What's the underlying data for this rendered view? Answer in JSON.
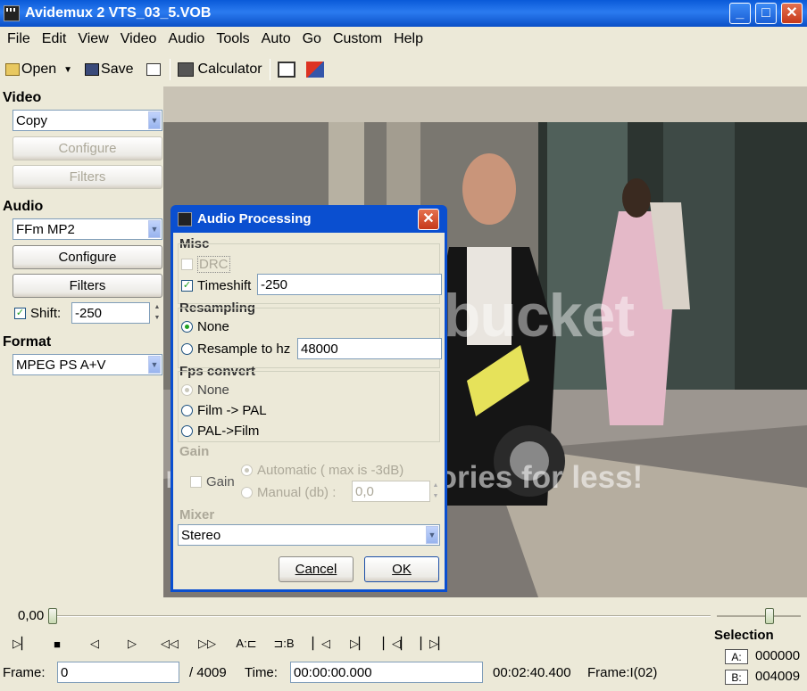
{
  "window": {
    "title": "Avidemux 2 VTS_03_5.VOB",
    "minimize": "_",
    "maximize": "□",
    "close": "✕"
  },
  "menu": [
    "File",
    "Edit",
    "View",
    "Video",
    "Audio",
    "Tools",
    "Auto",
    "Go",
    "Custom",
    "Help"
  ],
  "toolbar": {
    "open": "Open",
    "save": "Save",
    "calculator": "Calculator"
  },
  "sidebar": {
    "video_label": "Video",
    "video_codec": "Copy",
    "video_configure": "Configure",
    "video_filters": "Filters",
    "audio_label": "Audio",
    "audio_codec": "FFm MP2",
    "audio_configure": "Configure",
    "audio_filters": "Filters",
    "shift_label": "Shift:",
    "shift_value": "-250",
    "format_label": "Format",
    "format_value": "MPEG PS A+V"
  },
  "watermark": {
    "logo": "photobucket",
    "slogan": "Protect more of your memories for less!"
  },
  "dialog": {
    "title": "Audio Processing",
    "misc": "Misc",
    "drc": "DRC",
    "timeshift": "Timeshift",
    "timeshift_value": "-250",
    "resampling": "Resampling",
    "res_none": "None",
    "resample_to": "Resample to hz",
    "resample_value": "48000",
    "fps_convert": "Fps convert",
    "fps_none": "None",
    "film_pal": "Film -> PAL",
    "pal_film": "PAL->Film",
    "gain": "Gain",
    "gain_chk": "Gain",
    "automatic": "Automatic ( max is -3dB)",
    "manual": "Manual (db) :",
    "manual_value": "0,0",
    "mixer": "Mixer",
    "mixer_value": "Stereo",
    "cancel": "Cancel",
    "ok": "OK"
  },
  "timeline": {
    "position": "0,00"
  },
  "status": {
    "frame_label": "Frame:",
    "frame_value": "0",
    "total_frames": "/ 4009",
    "time_label": "Time:",
    "time_value": "00:00:00.000",
    "duration": "00:02:40.400",
    "frame_type": "Frame:I(02)",
    "selection_label": "Selection",
    "sel_a_label": "A:",
    "sel_a": "000000",
    "sel_b_label": "B:",
    "sel_b": "004009"
  }
}
